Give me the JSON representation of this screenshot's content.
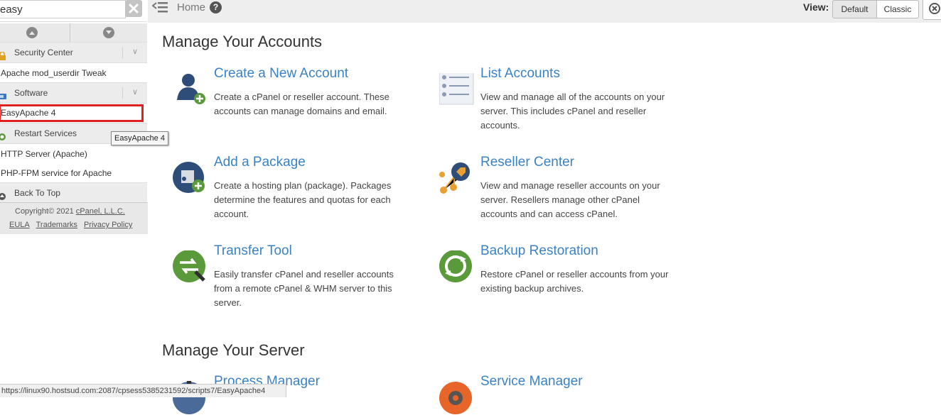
{
  "sidebar": {
    "search": {
      "value": "easy",
      "placeholder": ""
    },
    "items": [
      {
        "type": "category",
        "label": "Security Center"
      },
      {
        "type": "item",
        "label": "Apache mod_userdir Tweak"
      },
      {
        "type": "category",
        "label": "Software"
      },
      {
        "type": "item",
        "label": "EasyApache 4"
      },
      {
        "type": "category",
        "label": "Restart Services"
      },
      {
        "type": "item",
        "label": "HTTP Server (Apache)"
      },
      {
        "type": "item",
        "label": "PHP-FPM service for Apache"
      },
      {
        "type": "category",
        "label": "Back To Top"
      }
    ],
    "tooltip": "EasyApache 4",
    "footer": {
      "copyright_prefix": "Copyright© 2021 ",
      "company": "cPanel, L.L.C.",
      "links": [
        "EULA",
        "Trademarks",
        "Privacy Policy"
      ]
    }
  },
  "topbar": {
    "breadcrumb": "Home",
    "view_label": "View:",
    "view_default": "Default",
    "view_classic": "Classic"
  },
  "main": {
    "sections": [
      {
        "title": "Manage Your Accounts",
        "cards": [
          {
            "title": "Create a New Account",
            "desc": "Create a cPanel or reseller account. These accounts can manage domains and email.",
            "icon": "user-add-icon"
          },
          {
            "title": "List Accounts",
            "desc": "View and manage all of the accounts on your server. This includes cPanel and reseller accounts.",
            "icon": "list-accounts-icon"
          },
          {
            "title": "Add a Package",
            "desc": "Create a hosting plan (package). Packages determine the features and quotas for each account.",
            "icon": "package-add-icon"
          },
          {
            "title": "Reseller Center",
            "desc": "View and manage reseller accounts on your server. Resellers manage other cPanel accounts and can access cPanel.",
            "icon": "reseller-tag-icon"
          },
          {
            "title": "Transfer Tool",
            "desc": "Easily transfer cPanel and reseller accounts from a remote cPanel & WHM server to this server.",
            "icon": "transfer-icon"
          },
          {
            "title": "Backup Restoration",
            "desc": "Restore cPanel or reseller accounts from your existing backup archives.",
            "icon": "backup-restore-icon"
          }
        ]
      },
      {
        "title": "Manage Your Server",
        "cards": [
          {
            "title": "Process Manager",
            "desc": "",
            "icon": "process-manager-icon"
          },
          {
            "title": "Service Manager",
            "desc": "",
            "icon": "service-manager-icon"
          }
        ]
      }
    ]
  },
  "statusbar": {
    "url": "https://linux90.hostsud.com:2087/cpsess5385231592/scripts7/EasyApache4"
  },
  "colors": {
    "link": "#3b82c4",
    "highlight": "#e02020",
    "green": "#5a9a3a"
  }
}
